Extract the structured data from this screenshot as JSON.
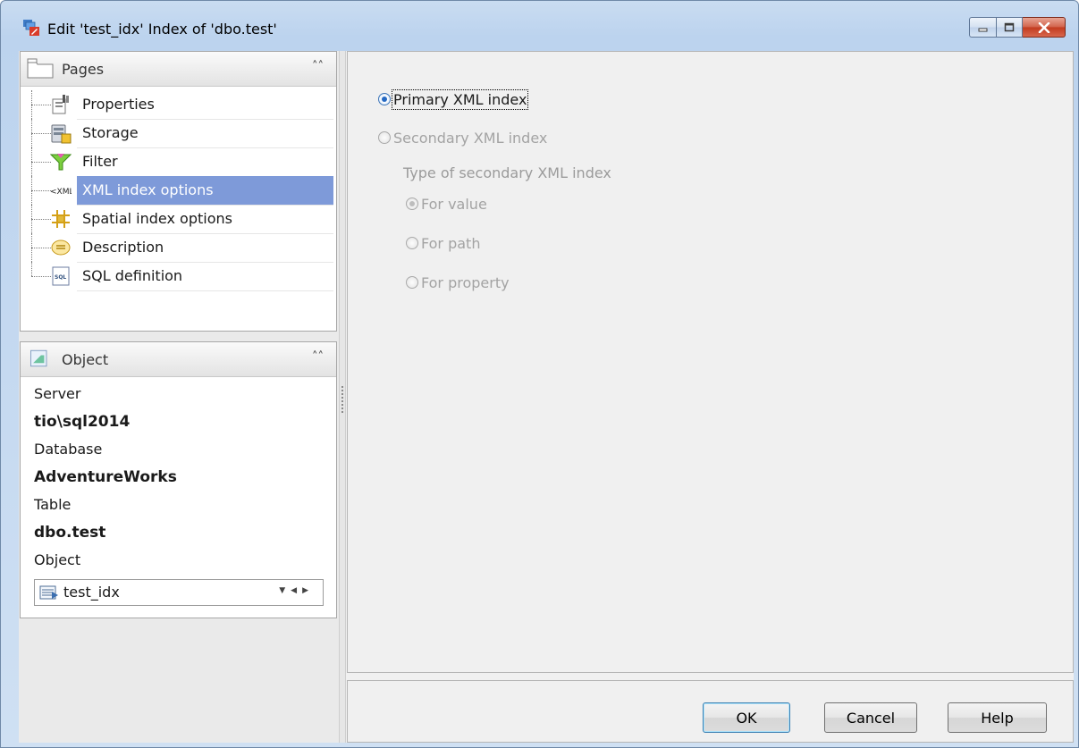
{
  "window": {
    "title": "Edit 'test_idx' Index of 'dbo.test'",
    "icon": "index-edit-icon",
    "controls": [
      "minimize-icon",
      "maximize-icon",
      "close-icon"
    ]
  },
  "pages_panel": {
    "title": "Pages",
    "items": [
      {
        "label": "Properties",
        "icon": "properties-icon"
      },
      {
        "label": "Storage",
        "icon": "storage-icon"
      },
      {
        "label": "Filter",
        "icon": "filter-icon"
      },
      {
        "label": "XML index options",
        "icon": "xml-icon",
        "selected": true
      },
      {
        "label": "Spatial index options",
        "icon": "spatial-grid-icon"
      },
      {
        "label": "Description",
        "icon": "description-icon"
      },
      {
        "label": "SQL definition",
        "icon": "sql-icon"
      }
    ]
  },
  "object_panel": {
    "title": "Object",
    "server_label": "Server",
    "server_value": "tio\\sql2014",
    "database_label": "Database",
    "database_value": "AdventureWorks",
    "table_label": "Table",
    "table_value": "dbo.test",
    "object_label": "Object",
    "object_value": "test_idx"
  },
  "xml_options": {
    "primary_label": "Primary XML index",
    "primary_checked": true,
    "secondary_label": "Secondary XML index",
    "secondary_group_label": "Type of secondary XML index",
    "secondary_types": [
      {
        "label": "For value",
        "checked": true
      },
      {
        "label": "For path",
        "checked": false
      },
      {
        "label": "For property",
        "checked": false
      }
    ]
  },
  "buttons": {
    "ok": "OK",
    "cancel": "Cancel",
    "help": "Help"
  }
}
